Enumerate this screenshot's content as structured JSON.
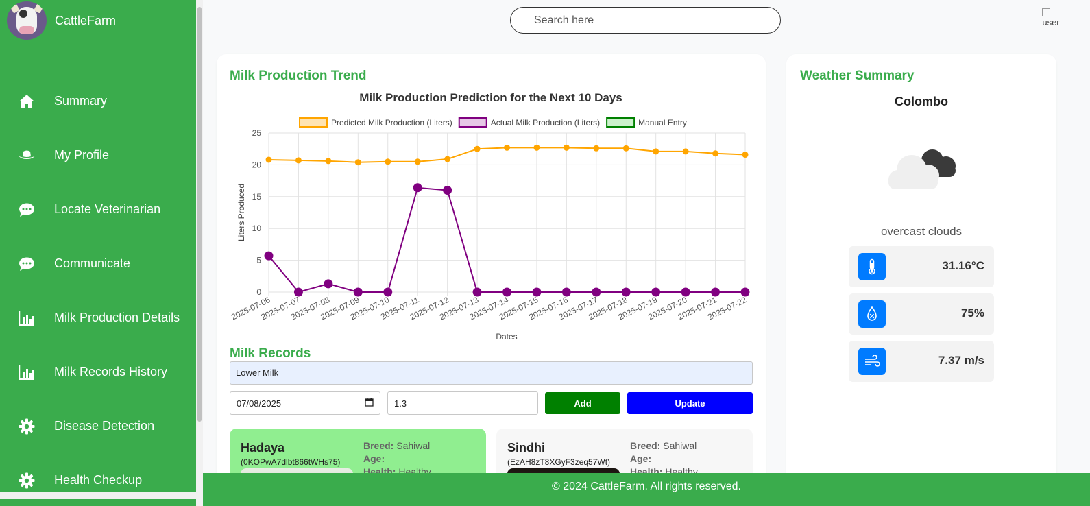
{
  "brand": {
    "name": "CattleFarm"
  },
  "search": {
    "placeholder": "Search here"
  },
  "user": {
    "alt": "user"
  },
  "sidebar": {
    "items": [
      {
        "label": "Summary",
        "icon": "home-icon"
      },
      {
        "label": "My Profile",
        "icon": "cowboy-hat-icon"
      },
      {
        "label": "Locate Veterinarian",
        "icon": "chat-icon"
      },
      {
        "label": "Communicate",
        "icon": "chat-icon"
      },
      {
        "label": "Milk Production Details",
        "icon": "bar-chart-icon"
      },
      {
        "label": "Milk Records History",
        "icon": "bar-chart-icon"
      },
      {
        "label": "Disease Detection",
        "icon": "gear-icon"
      },
      {
        "label": "Health Checkup",
        "icon": "gear-icon"
      }
    ]
  },
  "main": {
    "trend_title": "Milk Production Trend",
    "records_title": "Milk Records",
    "note_value": "Lower Milk",
    "date_value": "07/08/2025",
    "amount_value": "1.3",
    "add_label": "Add",
    "update_label": "Update"
  },
  "chart_data": {
    "type": "line",
    "title": "Milk Production Prediction for the Next 10 Days",
    "xlabel": "Dates",
    "ylabel": "Liters Produced",
    "ylim": [
      0,
      25
    ],
    "yticks": [
      0,
      5,
      10,
      15,
      20,
      25
    ],
    "grid": true,
    "legend_position": "top",
    "categories": [
      "2025-07-06",
      "2025-07-07",
      "2025-07-08",
      "2025-07-09",
      "2025-07-10",
      "2025-07-11",
      "2025-07-12",
      "2025-07-13",
      "2025-07-14",
      "2025-07-15",
      "2025-07-16",
      "2025-07-17",
      "2025-07-18",
      "2025-07-19",
      "2025-07-20",
      "2025-07-21",
      "2025-07-22"
    ],
    "series": [
      {
        "name": "Predicted Milk Production (Liters)",
        "color": "#ffa500",
        "fill": "#ffe4b3",
        "values": [
          20.8,
          20.7,
          20.6,
          20.4,
          20.5,
          20.5,
          20.9,
          22.5,
          22.7,
          22.7,
          22.7,
          22.6,
          22.6,
          22.1,
          22.1,
          21.8,
          21.6
        ]
      },
      {
        "name": "Actual Milk Production (Liters)",
        "color": "#800080",
        "fill": "#e6c8e6",
        "values": [
          5.7,
          0,
          1.3,
          0,
          0,
          16.4,
          16.0,
          0,
          0,
          0,
          0,
          0,
          0,
          0,
          0,
          0,
          0
        ]
      },
      {
        "name": "Manual Entry",
        "color": "#008000",
        "fill": "#ccf2cc",
        "values": []
      }
    ]
  },
  "cows": [
    {
      "name": "Hadaya",
      "id": "(0KOPwA7dlbt866tWHs75)",
      "breed_label": "Breed:",
      "breed": "Sahiwal",
      "age_label": "Age:",
      "age": "",
      "health_label": "Health:",
      "health": "Healthy"
    },
    {
      "name": "Sindhi",
      "id": "(EzAH8zT8XGyF3zeq57Wt)",
      "breed_label": "Breed:",
      "breed": "Sahiwal",
      "age_label": "Age:",
      "age": "",
      "health_label": "Health:",
      "health": "Healthy"
    }
  ],
  "weather": {
    "title": "Weather Summary",
    "city": "Colombo",
    "description": "overcast clouds",
    "temperature": "31.16°C",
    "humidity": "75%",
    "wind": "7.37 m/s"
  },
  "footer": {
    "text": "© 2024 CattleFarm. All rights reserved."
  }
}
